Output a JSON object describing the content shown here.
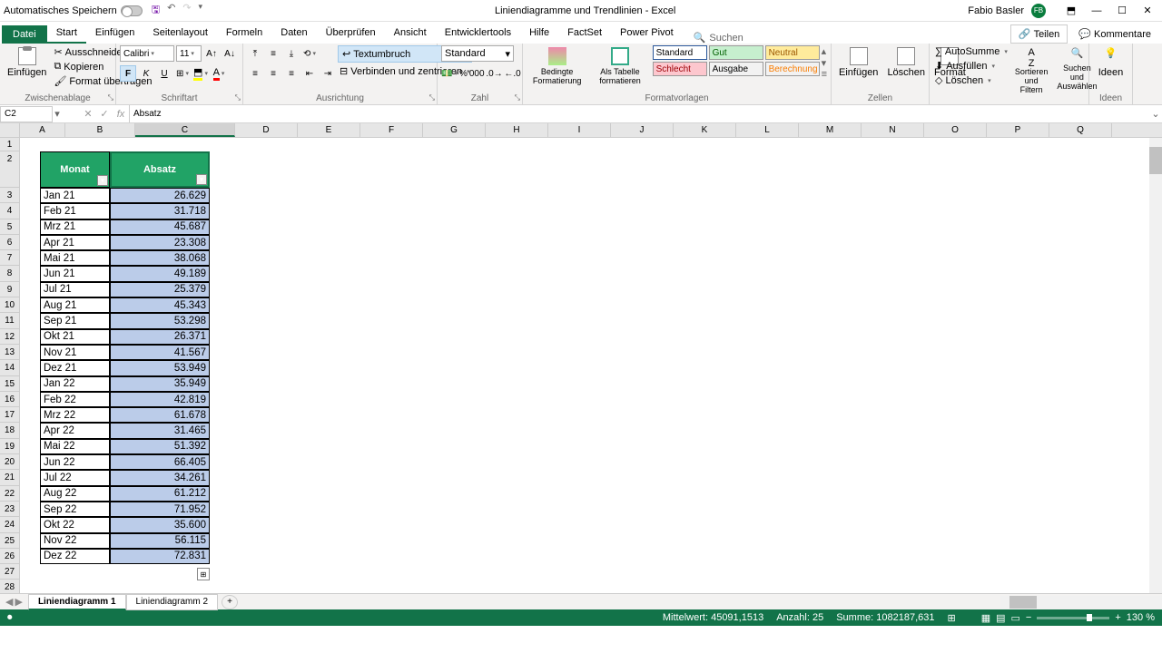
{
  "title_bar": {
    "autosave": "Automatisches Speichern",
    "document_title": "Liniendiagramme und Trendlinien  -  Excel",
    "user_name": "Fabio Basler",
    "user_initials": "FB"
  },
  "tabs": {
    "file": "Datei",
    "items": [
      "Start",
      "Einfügen",
      "Seitenlayout",
      "Formeln",
      "Daten",
      "Überprüfen",
      "Ansicht",
      "Entwicklertools",
      "Hilfe",
      "FactSet",
      "Power Pivot"
    ],
    "active": "Start",
    "search": "Suchen",
    "share": "Teilen",
    "comments": "Kommentare"
  },
  "ribbon": {
    "clipboard": {
      "paste": "Einfügen",
      "cut": "Ausschneiden",
      "copy": "Kopieren",
      "format_painter": "Format übertragen",
      "label": "Zwischenablage"
    },
    "font": {
      "name": "Calibri",
      "size": "11",
      "label": "Schriftart"
    },
    "alignment": {
      "wrap": "Textumbruch",
      "merge": "Verbinden und zentrieren",
      "label": "Ausrichtung"
    },
    "number": {
      "format": "Standard",
      "label": "Zahl"
    },
    "styles": {
      "conditional": "Bedingte Formatierung",
      "as_table": "Als Tabelle formatieren",
      "standard": "Standard",
      "bad": "Schlecht",
      "good": "Gut",
      "output": "Ausgabe",
      "neutral": "Neutral",
      "calc": "Berechnung",
      "label": "Formatvorlagen"
    },
    "cells": {
      "insert": "Einfügen",
      "delete": "Löschen",
      "format": "Format",
      "label": "Zellen"
    },
    "editing": {
      "autosum": "AutoSumme",
      "fill": "Ausfüllen",
      "clear": "Löschen",
      "sort": "Sortieren und Filtern",
      "find": "Suchen und Auswählen"
    },
    "ideas": {
      "label": "Ideen"
    }
  },
  "formula_bar": {
    "name_box": "C2",
    "formula": "Absatz"
  },
  "columns": [
    "A",
    "B",
    "C",
    "D",
    "E",
    "F",
    "G",
    "H",
    "I",
    "J",
    "K",
    "L",
    "M",
    "N",
    "O",
    "P",
    "Q"
  ],
  "col_widths": {
    "A": 50,
    "B": 77,
    "C": 110,
    "default": 69
  },
  "table": {
    "headers": [
      "Monat",
      "Absatz"
    ],
    "rows": [
      {
        "month": "Jan 21",
        "value": "26.629"
      },
      {
        "month": "Feb 21",
        "value": "31.718"
      },
      {
        "month": "Mrz 21",
        "value": "45.687"
      },
      {
        "month": "Apr 21",
        "value": "23.308"
      },
      {
        "month": "Mai 21",
        "value": "38.068"
      },
      {
        "month": "Jun 21",
        "value": "49.189"
      },
      {
        "month": "Jul 21",
        "value": "25.379"
      },
      {
        "month": "Aug 21",
        "value": "45.343"
      },
      {
        "month": "Sep 21",
        "value": "53.298"
      },
      {
        "month": "Okt 21",
        "value": "26.371"
      },
      {
        "month": "Nov 21",
        "value": "41.567"
      },
      {
        "month": "Dez 21",
        "value": "53.949"
      },
      {
        "month": "Jan 22",
        "value": "35.949"
      },
      {
        "month": "Feb 22",
        "value": "42.819"
      },
      {
        "month": "Mrz 22",
        "value": "61.678"
      },
      {
        "month": "Apr 22",
        "value": "31.465"
      },
      {
        "month": "Mai 22",
        "value": "51.392"
      },
      {
        "month": "Jun 22",
        "value": "66.405"
      },
      {
        "month": "Jul 22",
        "value": "34.261"
      },
      {
        "month": "Aug 22",
        "value": "61.212"
      },
      {
        "month": "Sep 22",
        "value": "71.952"
      },
      {
        "month": "Okt 22",
        "value": "35.600"
      },
      {
        "month": "Nov 22",
        "value": "56.115"
      },
      {
        "month": "Dez 22",
        "value": "72.831"
      }
    ]
  },
  "sheet_tabs": {
    "tabs": [
      "Liniendiagramm 1",
      "Liniendiagramm 2"
    ],
    "active": "Liniendiagramm 1"
  },
  "status_bar": {
    "avg_label": "Mittelwert:",
    "avg": "45091,1513",
    "count_label": "Anzahl:",
    "count": "25",
    "sum_label": "Summe:",
    "sum": "1082187,631",
    "zoom": "130 %"
  }
}
